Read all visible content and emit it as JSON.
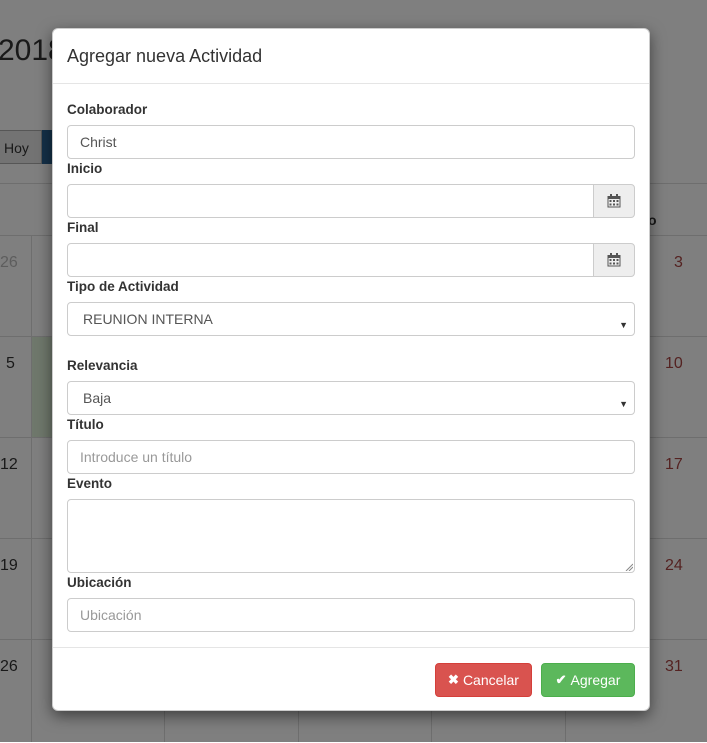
{
  "background": {
    "title_fragment": "2018",
    "today_button": "Hoy",
    "weekday_fragment": "o",
    "days_left": [
      "26",
      "5",
      "12",
      "19",
      "26"
    ],
    "days_right": [
      "3",
      "10",
      "17",
      "24",
      "31"
    ]
  },
  "modal": {
    "title": "Agregar nueva Actividad",
    "fields": {
      "colaborador": {
        "label": "Colaborador",
        "value": "Christ"
      },
      "inicio": {
        "label": "Inicio",
        "value": "",
        "icon": "calendar-icon"
      },
      "final": {
        "label": "Final",
        "value": "",
        "icon": "calendar-icon"
      },
      "tipo": {
        "label": "Tipo de Actividad",
        "value": "REUNION INTERNA"
      },
      "relevancia": {
        "label": "Relevancia",
        "value": "Baja"
      },
      "titulo": {
        "label": "Título",
        "placeholder": "Introduce un título"
      },
      "evento": {
        "label": "Evento",
        "value": ""
      },
      "ubicacion": {
        "label": "Ubicación",
        "placeholder": "Ubicación"
      }
    },
    "buttons": {
      "cancel": {
        "label": "Cancelar",
        "icon": "times-icon",
        "color": "#d9534f"
      },
      "add": {
        "label": "Agregar",
        "icon": "check-icon",
        "color": "#5cb85c"
      }
    }
  }
}
